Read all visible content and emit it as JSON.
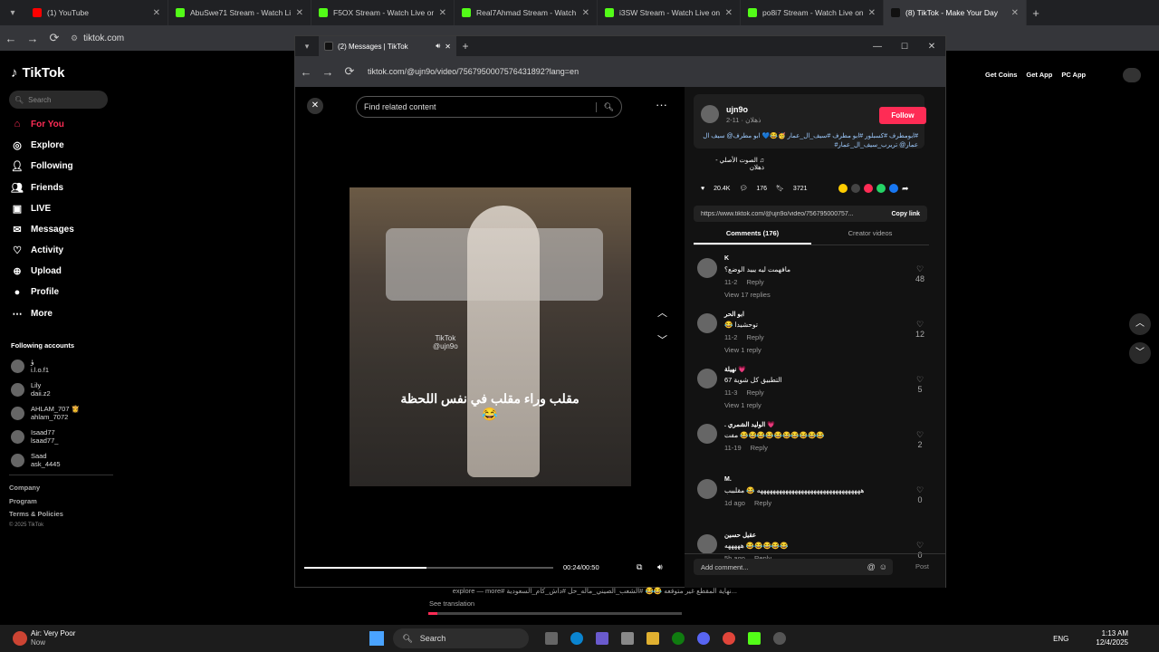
{
  "tabs": [
    {
      "title": "(1) YouTube",
      "color": "#ff0000"
    },
    {
      "title": "AbuSwe71 Stream - Watch Live",
      "color": "#53fc18"
    },
    {
      "title": "F5OX Stream - Watch Live on K",
      "color": "#53fc18"
    },
    {
      "title": "Real7Ahmad Stream - Watch L",
      "color": "#53fc18"
    },
    {
      "title": "i3SW Stream - Watch Live on K",
      "color": "#53fc18"
    },
    {
      "title": "po8i7 Stream - Watch Live on K",
      "color": "#53fc18"
    },
    {
      "title": "(8) TikTok - Make Your Day",
      "color": "#111111"
    }
  ],
  "address": {
    "url": "tiktok.com"
  },
  "sidebar": {
    "logo": "TikTok",
    "search_placeholder": "Search",
    "nav": [
      {
        "label": "For You",
        "icon": "home-icon",
        "color": "#fe2c55"
      },
      {
        "label": "Explore",
        "icon": "compass-icon",
        "color": "#ffffff"
      },
      {
        "label": "Following",
        "icon": "following-icon",
        "color": "#ffffff"
      },
      {
        "label": "Friends",
        "icon": "friends-icon",
        "color": "#ffffff"
      },
      {
        "label": "LIVE",
        "icon": "live-icon",
        "color": "#ffffff"
      },
      {
        "label": "Messages",
        "icon": "message-icon",
        "color": "#ffffff"
      },
      {
        "label": "Activity",
        "icon": "activity-icon",
        "color": "#ffffff"
      },
      {
        "label": "Upload",
        "icon": "upload-icon",
        "color": "#ffffff"
      },
      {
        "label": "Profile",
        "icon": "profile-icon",
        "color": "#ffffff"
      },
      {
        "label": "More",
        "icon": "more-icon",
        "color": "#ffffff"
      }
    ],
    "following_title": "Following accounts",
    "accounts": [
      {
        "name": "ؤ",
        "handle": "i.l.o.f1"
      },
      {
        "name": "Lily",
        "handle": "daii.z2"
      },
      {
        "name": "AHLAM_707 👸",
        "handle": "ahlam_7072"
      },
      {
        "name": "Isaad77",
        "handle": "lsaad77_"
      },
      {
        "name": "Saad",
        "handle": "ask_4445"
      }
    ],
    "footer": [
      "Company",
      "Program",
      "Terms & Policies"
    ],
    "copyright": "© 2025 TikTok"
  },
  "header_right": [
    "Get Coins",
    "Get App",
    "PC App"
  ],
  "popup": {
    "tab_title": "(2) Messages | TikTok",
    "url": "tiktok.com/@ujn9o/video/7567950007576431892?lang=en",
    "find_placeholder": "Find related content",
    "caption": "مقلب وراء مقلب في نفس اللحظة 😂",
    "watermark": "TikTok",
    "watermark_handle": "@ujn9o",
    "time": "00:24/00:50",
    "progress": 0.49,
    "author": {
      "handle": "ujn9o",
      "sub": "ذهلان · 11-2",
      "follow": "Follow"
    },
    "desc": "#ابومطرف #كسبلور #ابو مطرف #سيف_ال_عمار 🥳😂💙 ابو مطرف@ سيف ال عمار@ تريرب_سيف_ال_عمار#",
    "sound": "♫ الصوت الأصلي - ذهلان",
    "stats": {
      "likes": "20.4K",
      "comments": "176",
      "saves": "3721"
    },
    "link": "https://www.tiktok.com/@ujn9o/video/756795000757...",
    "copy_link": "Copy link",
    "tab_comments": "Comments (176)",
    "tab_creator": "Creator videos",
    "comments": [
      {
        "user": "K",
        "text": "مافهمت ليه يبيد الوضع؟",
        "date": "11-2",
        "reply": "Reply",
        "likes": "48",
        "view": "View 17 replies"
      },
      {
        "user": "ابو الحر",
        "text": "توحشيدا 😂",
        "date": "11-2",
        "reply": "Reply",
        "likes": "12",
        "view": "View 1 reply"
      },
      {
        "user": "نهيلة 💗",
        "text": "التطبيق كل شوية 67",
        "date": "11-3",
        "reply": "Reply",
        "likes": "5",
        "view": "View 1 reply"
      },
      {
        "user": ". الوليد الشمري 💗",
        "text": "😂😂😂😂😂😂😂😂😂😂 مفت",
        "date": "11-19",
        "reply": "Reply",
        "likes": "2",
        "view": ""
      },
      {
        "user": "M.",
        "text": "هههههههههههههههههههههههههههههههههه 😂 مقلببب",
        "date": "1d ago",
        "reply": "Reply",
        "likes": "0",
        "view": ""
      },
      {
        "user": "عقيل حسين",
        "text": "😂😂😂😂😂 هههههه",
        "date": "5h ago",
        "reply": "Reply",
        "likes": "0",
        "view": ""
      }
    ],
    "add_comment": "Add comment...",
    "post": "Post"
  },
  "below": {
    "caption": "...نهاية المقطع غير متوقعه 😂😂 #الشعب_الصيني_ماله_حل #داش_كام_السعودية #explore — more",
    "see": "See translation"
  },
  "taskbar": {
    "weather": "Air: Very Poor",
    "weather_sub": "Now",
    "search": "Search",
    "lang": "ENG",
    "time": "1:13 AM",
    "date": "12/4/2025"
  }
}
